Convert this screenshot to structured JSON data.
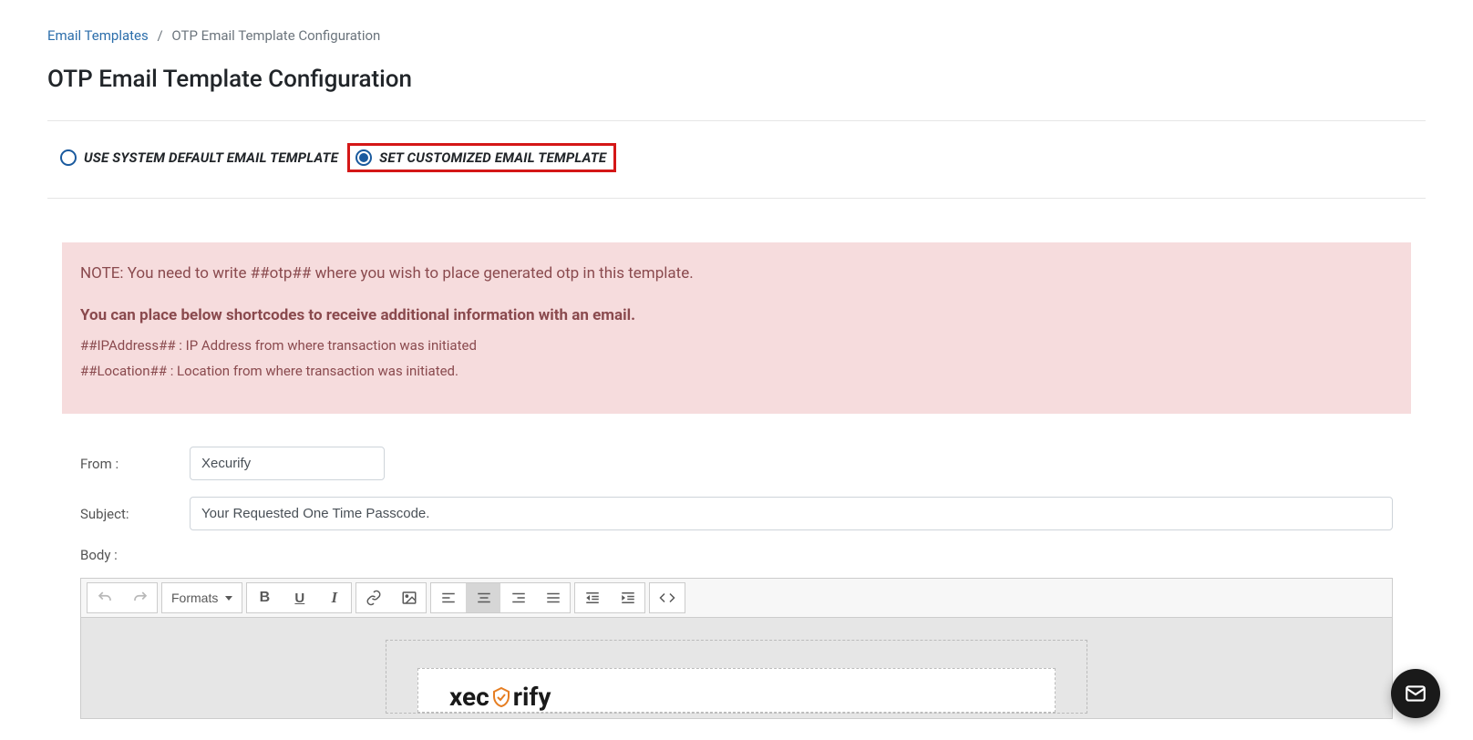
{
  "breadcrumb": {
    "parent": "Email Templates",
    "current": "OTP Email Template Configuration"
  },
  "page_title": "OTP Email Template Configuration",
  "radios": {
    "default_label": "USE SYSTEM DEFAULT EMAIL TEMPLATE",
    "custom_label": "SET CUSTOMIZED EMAIL TEMPLATE"
  },
  "note": {
    "line1": "NOTE: You need to write ##otp## where you wish to place generated otp in this template.",
    "heading": "You can place below shortcodes to receive additional information with an email.",
    "shortcode1": "##IPAddress## : IP Address from where transaction was initiated",
    "shortcode2": "##Location## : Location from where transaction was initiated."
  },
  "form": {
    "from_label": "From :",
    "from_value": "Xecurify",
    "subject_label": "Subject:",
    "subject_value": "Your Requested One Time Passcode.",
    "body_label": "Body :"
  },
  "toolbar": {
    "formats": "Formats"
  },
  "logo": {
    "prefix": "xec",
    "suffix": "rify"
  }
}
